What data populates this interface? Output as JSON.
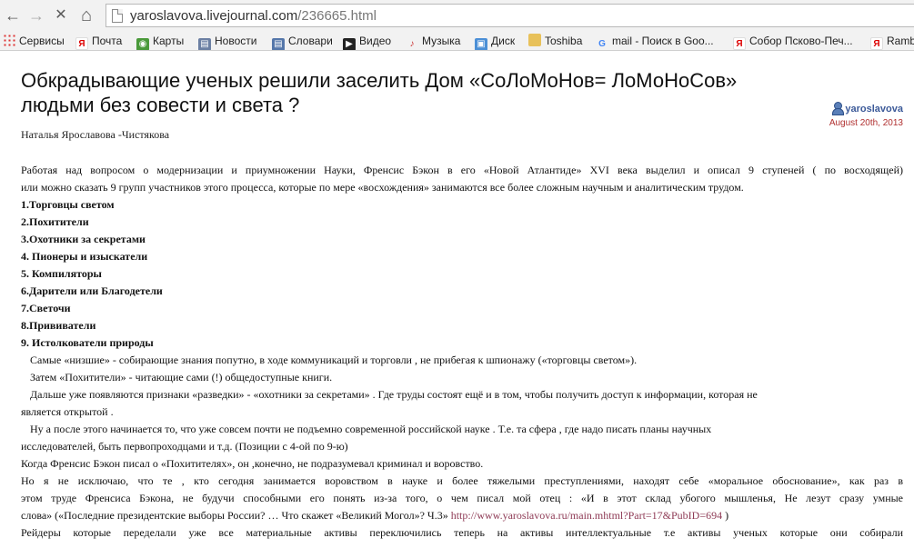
{
  "browser": {
    "url_host": "yaroslavova.livejournal.com",
    "url_path": "/236665.html",
    "back_glyph": "←",
    "forward_glyph": "→",
    "stop_glyph": "✕",
    "home_glyph": "⌂"
  },
  "bookmarks": [
    {
      "label": "Сервисы",
      "icon": "apps-icon",
      "glyph": ""
    },
    {
      "label": "Почта",
      "icon": "yandex-icon",
      "glyph": "Я"
    },
    {
      "label": "Карты",
      "icon": "maps-icon",
      "glyph": "◉"
    },
    {
      "label": "Новости",
      "icon": "news-icon",
      "glyph": "▤"
    },
    {
      "label": "Словари",
      "icon": "dictionary-icon",
      "glyph": "▤"
    },
    {
      "label": "Видео",
      "icon": "video-icon",
      "glyph": "▶"
    },
    {
      "label": "Музыка",
      "icon": "music-icon",
      "glyph": "♪"
    },
    {
      "label": "Диск",
      "icon": "disk-icon",
      "glyph": "▣"
    },
    {
      "label": "Toshiba",
      "icon": "folder-icon",
      "glyph": ""
    },
    {
      "label": "mail - Поиск в Goo...",
      "icon": "google-icon",
      "glyph": "G"
    },
    {
      "label": "Собор Псково-Печ...",
      "icon": "yandex-icon",
      "glyph": "Я"
    },
    {
      "label": "Ramb",
      "icon": "yandex-icon",
      "glyph": "Я"
    }
  ],
  "post": {
    "title": "Обкрадывающие ученых решили заселить Дом «СоЛоМоНов= ЛоМоНоСов» людьми без совести и света ?",
    "username": "yaroslavova",
    "date": "August 20th, 2013",
    "author": "Наталья  Ярославова -Чистякова",
    "intro_1": "Работая  над вопросом о   модернизации и приумножении  Науки, Френсис  Бэкон в    его     «Новой Атлантиде» XVI века  выделил и описал    9  ступеней ( по восходящей)",
    "intro_2": "или  можно сказать      9 групп участников  этого процесса,  которые  по мере  «восхождения» занимаются  все  более  сложным  научным и аналитическим трудом.",
    "list": [
      "1.Торговцы  светом",
      "2.Похитители",
      "3.Охотники  за  секретами",
      "4. Пионеры и изыскатели",
      "5. Компиляторы",
      "6.Дарители или Благодетели",
      "7.Светочи",
      "8.Прививатели",
      "9. Истолкователи природы"
    ],
    "p1": "Самые  «низшие» - собирающие  знания  попутно,     в  ходе   коммуникаций и торговли , не  прибегая  к  шпионажу  («торговцы  светом»).",
    "p2": "Затем    «Похитители» - читающие      сами (!)   общедоступные книги.",
    "p3a": "Дальше   уже появляются признаки «разведки» - «охотники  за секретами» .   Где  труды  состоят  ещё  и в  том, чтобы  получить  доступ к информации, которая не",
    "p3b": "является  открытой .",
    "p4a": "Ну   а  после  этого    начинается  то, что    уже совсем  почти  не  подъемно  современной      российской науке .   Т.е.     та сфера , где  надо писать  планы  научных",
    "p4b": "исследователей,   быть первопроходцами и  т.д. (Позиции с    4-ой по 9-ю)",
    "p5": "Когда   Френсис  Бэкон  писал о      «Похитителях»,     он ,конечно,    не подразумевал      криминал и воровство.",
    "p6a": "Но  я не исключаю, что  те  , кто сегодня занимается  воровством в науке и    более тяжелыми преступлениями,       находят  себе       «моральное  обоснование»,  как   раз   в",
    "p6b": "этом    труде  Френсиса  Бэкона,   не  будучи  способными  его  понять     из-за того, о чем  писал мой отец  : «И в этот склад убогого мышленья, Не лезут сразу умные",
    "p6c_text": "слова»    («Последние президентские выборы России? … Что скажет «Великий Могол»? Ч.3»",
    "p6c_link": "http://www.yaroslavova.ru/main.mhtml?Part=17&PubID=694",
    "p6c_end": ")",
    "p7": "Рейдеры  которые    переделали уже  все материальные  активы        переключились теперь на  активы   интеллектуальные  т.е  активы  ученых   которые  они собирали"
  }
}
